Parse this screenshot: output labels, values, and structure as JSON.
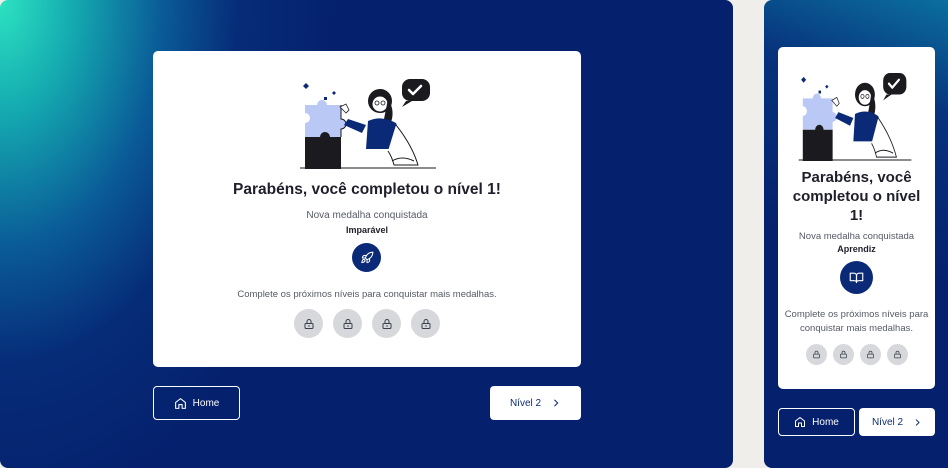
{
  "desktop": {
    "title": "Parabéns, você completou o nível 1!",
    "subtitle": "Nova medalha conquistada",
    "medal_name": "Imparável",
    "medal_icon": "rocket-icon",
    "cta": "Complete os próximos níveis para conquistar mais medalhas.",
    "locked_medals": [
      "lock-icon",
      "lock-icon",
      "lock-icon",
      "lock-icon"
    ],
    "home_label": "Home",
    "next_label": "Nível 2"
  },
  "mobile": {
    "title": "Parabéns, você completou o nível 1!",
    "subtitle": "Nova medalha conquistada",
    "medal_name": "Aprendiz",
    "medal_icon": "book-icon",
    "cta": "Complete os próximos níveis para conquistar mais medalhas.",
    "locked_medals": [
      "lock-icon",
      "lock-icon",
      "lock-icon",
      "lock-icon"
    ],
    "home_label": "Home",
    "next_label": "Nível 2"
  },
  "colors": {
    "brand_navy": "#0a2a78",
    "accent_teal": "#2de3c1",
    "locked_gray": "#d7d8dc",
    "puzzle_light": "#b9c8f5"
  }
}
